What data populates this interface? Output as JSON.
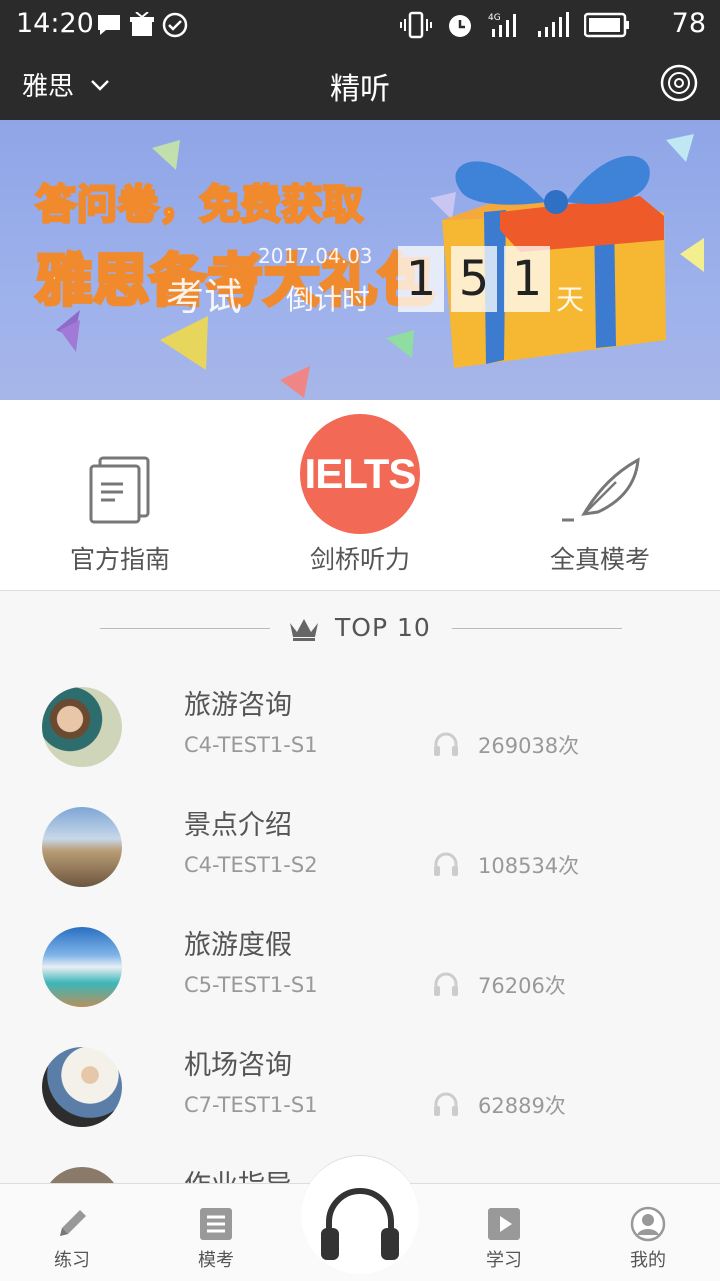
{
  "status_bar": {
    "time": "14:20",
    "battery": "78"
  },
  "app_bar": {
    "exam": "雅思",
    "title": "精听"
  },
  "banner": {
    "promo_line1": "答问卷，免费获取",
    "promo_line2": "雅思备考大礼包",
    "overlay_word": "考试",
    "date_text": "2017.04.03",
    "countdown_label": "倒计时",
    "countdown_digits": [
      "1",
      "5",
      "1"
    ],
    "day_unit": "天"
  },
  "shortcuts": [
    {
      "label": "官方指南",
      "icon": "document-icon"
    },
    {
      "label": "剑桥听力",
      "icon": "ielts-logo",
      "logo_text": "IELTS"
    },
    {
      "label": "全真模考",
      "icon": "feather-pen-icon"
    }
  ],
  "top_header": {
    "label": "TOP  10"
  },
  "list": [
    {
      "title": "旅游咨询",
      "code": "C4-TEST1-S1",
      "count": "269038次"
    },
    {
      "title": "景点介绍",
      "code": "C4-TEST1-S2",
      "count": "108534次"
    },
    {
      "title": "旅游度假",
      "code": "C5-TEST1-S1",
      "count": "76206次"
    },
    {
      "title": "机场咨询",
      "code": "C7-TEST1-S1",
      "count": "62889次"
    },
    {
      "title": "作业指导",
      "code": "",
      "count": ""
    }
  ],
  "bottom_nav": [
    {
      "label": "练习",
      "icon": "pencil-icon"
    },
    {
      "label": "模考",
      "icon": "list-icon"
    },
    {
      "label": "",
      "icon": "headphones-icon"
    },
    {
      "label": "学习",
      "icon": "play-icon"
    },
    {
      "label": "我的",
      "icon": "user-icon"
    }
  ],
  "colors": {
    "bar": "#2b2b2b",
    "ielts": "#f26a55",
    "banner": "#9db1ec"
  }
}
